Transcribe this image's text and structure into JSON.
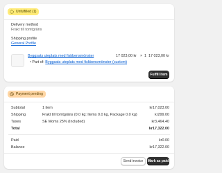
{
  "fulfillment": {
    "badge": "Unfulfilled (1)",
    "delivery_method_label": "Delivery method",
    "delivery_method_value": "Frakt till tomtgräns",
    "shipping_profile_label": "Shipping profile",
    "shipping_profile_value": "General Profile",
    "line_item": {
      "title": "Byggsats uteplats med fiskbensmönster",
      "price": "17 023,00 kr",
      "multiply": "×",
      "quantity": "1",
      "total": "17 023,00 kr",
      "part_of_prefix": "Part of:",
      "part_of_link": "Byggsats uteplats med fiskbensmönster (custom)"
    },
    "fulfill_button": "Fulfill item"
  },
  "payment": {
    "badge": "Payment pending",
    "rows": [
      {
        "label": "Subtotal",
        "detail": "1 item",
        "amount": "kr17,023.00"
      },
      {
        "label": "Shipping",
        "detail": "Frakt till tomtgräns (0.0 kg: Items 0.0 kg, Package 0.0 kg)",
        "amount": "kr299.00"
      },
      {
        "label": "Taxes",
        "detail": "SE Moms 25% (Included)",
        "amount": "kr3,464.40"
      },
      {
        "label": "Total",
        "detail": "",
        "amount": "kr17,322.00"
      }
    ],
    "paid_label": "Paid",
    "paid_amount": "kr0.00",
    "balance_label": "Balance",
    "balance_amount": "kr17,322.00",
    "send_invoice_button": "Send invoice",
    "mark_as_paid_button": "Mark as paid"
  },
  "icons": {
    "unfulfilled": "unfulfilled-status-icon",
    "pending": "payment-pending-icon"
  },
  "colors": {
    "unfulfilled_badge": "#ffeb78",
    "pending_badge": "#ffd6a4",
    "link": "#005bd3",
    "primary_button": "#303030"
  }
}
